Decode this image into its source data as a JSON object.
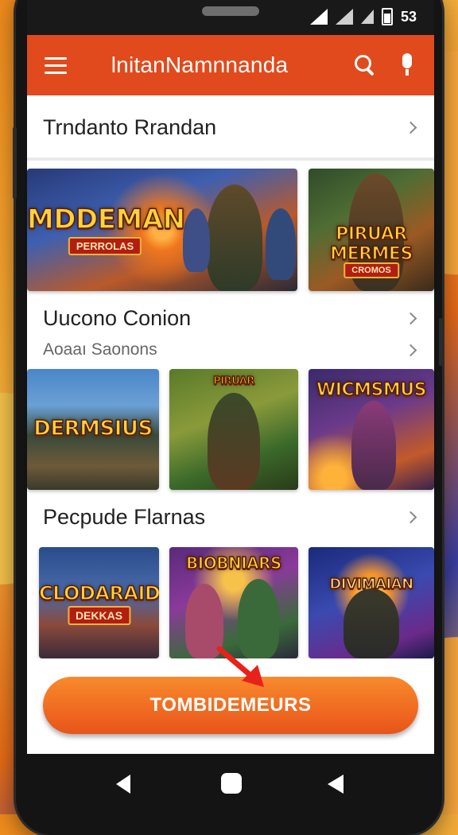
{
  "status_bar": {
    "time": "53"
  },
  "app_bar": {
    "title": "lnitanNamnnanda"
  },
  "sections": [
    {
      "title": "Trndanto Rrandan"
    },
    {
      "title": "Uucono Conion",
      "subtitle": "Aoaaı Saonons"
    },
    {
      "title": "Pecpude Flarnas"
    }
  ],
  "games": {
    "row1": [
      {
        "title": "MDDEMAN",
        "subtitle": "PERROLAS"
      },
      {
        "title": "PIRUAR MERMES",
        "subtitle": "CROMOS"
      }
    ],
    "row2": [
      {
        "title": "DERMSIUS"
      },
      {
        "title": "PIRUAR"
      },
      {
        "title": "WICMSMUS"
      }
    ],
    "row3": [
      {
        "title": "CLODARAID",
        "subtitle": "DEKKAS"
      },
      {
        "title": "BIOBNIARS"
      },
      {
        "title": "DIVIMAIAN"
      }
    ]
  },
  "cta": {
    "label": "TOMBIDEMEURS"
  },
  "colors": {
    "app_bar": "#e14a1c",
    "cta": "#f07a28"
  },
  "icons": [
    "menu-icon",
    "search-icon",
    "mic-icon",
    "chevron-right-icon",
    "arrow-icon",
    "back-icon",
    "home-icon",
    "recents-icon"
  ]
}
